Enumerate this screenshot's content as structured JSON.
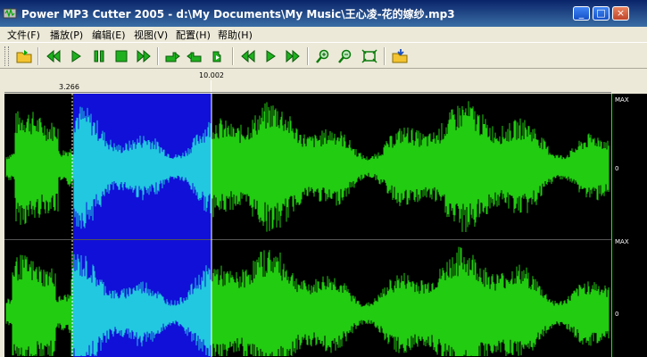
{
  "window": {
    "title": "Power MP3 Cutter 2005 - d:\\My Documents\\My Music\\王心凌-花的嫁纱.mp3",
    "buttons": {
      "minimize": "_",
      "maximize": "□",
      "close": "×"
    }
  },
  "menu": {
    "items": [
      "文件(F)",
      "播放(P)",
      "编辑(E)",
      "视图(V)",
      "配置(H)",
      "帮助(H)"
    ]
  },
  "toolbar": {
    "icons": [
      "open-folder-icon",
      "rewind-icon",
      "play-icon",
      "pause-icon",
      "stop-icon",
      "forward-icon",
      "mark-start-hand-icon",
      "mark-end-hand-icon",
      "play-selection-hand-icon",
      "prev-mark-icon",
      "play-from-mark-icon",
      "next-mark-icon",
      "zoom-in-icon",
      "zoom-out-icon",
      "zoom-fit-icon",
      "save-export-icon"
    ]
  },
  "ruler": {
    "selection_start": "3.266",
    "cursor_position": "10.002"
  },
  "meter": {
    "max_label_top": "MAX",
    "zero_label_top": "0",
    "max_label_bottom": "MAX",
    "zero_label_bottom": "0"
  },
  "colors": {
    "waveform": "#22cc11",
    "selection_bg": "#1010d8",
    "selection_wave": "#22c8e0",
    "background": "#000000",
    "cursor": "#ffffff"
  }
}
